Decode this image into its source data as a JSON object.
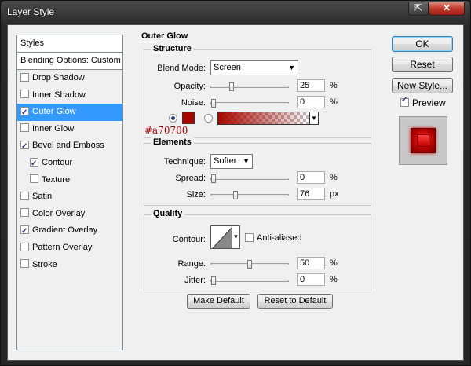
{
  "window": {
    "title": "Layer Style"
  },
  "styles_list": {
    "header": "Styles",
    "blending_options": "Blending Options: Custom",
    "items": [
      {
        "label": "Drop Shadow",
        "checked": false,
        "selected": false,
        "indent": false
      },
      {
        "label": "Inner Shadow",
        "checked": false,
        "selected": false,
        "indent": false
      },
      {
        "label": "Outer Glow",
        "checked": true,
        "selected": true,
        "indent": false
      },
      {
        "label": "Inner Glow",
        "checked": false,
        "selected": false,
        "indent": false
      },
      {
        "label": "Bevel and Emboss",
        "checked": true,
        "selected": false,
        "indent": false
      },
      {
        "label": "Contour",
        "checked": true,
        "selected": false,
        "indent": true
      },
      {
        "label": "Texture",
        "checked": false,
        "selected": false,
        "indent": true
      },
      {
        "label": "Satin",
        "checked": false,
        "selected": false,
        "indent": false
      },
      {
        "label": "Color Overlay",
        "checked": false,
        "selected": false,
        "indent": false
      },
      {
        "label": "Gradient Overlay",
        "checked": true,
        "selected": false,
        "indent": false
      },
      {
        "label": "Pattern Overlay",
        "checked": false,
        "selected": false,
        "indent": false
      },
      {
        "label": "Stroke",
        "checked": false,
        "selected": false,
        "indent": false
      }
    ]
  },
  "panel": {
    "title": "Outer Glow",
    "structure": {
      "title": "Structure",
      "blend_mode_label": "Blend Mode:",
      "blend_mode_value": "Screen",
      "opacity_label": "Opacity:",
      "opacity_value": "25",
      "opacity_fraction": 0.25,
      "noise_label": "Noise:",
      "noise_value": "0",
      "noise_fraction": 0.0,
      "percent": "%",
      "color_hex_label": "#a70700",
      "color": "#a70700"
    },
    "elements": {
      "title": "Elements",
      "technique_label": "Technique:",
      "technique_value": "Softer",
      "spread_label": "Spread:",
      "spread_value": "0",
      "spread_fraction": 0.0,
      "size_label": "Size:",
      "size_value": "76",
      "size_unit": "px",
      "size_fraction": 0.3
    },
    "quality": {
      "title": "Quality",
      "contour_label": "Contour:",
      "anti_aliased_label": "Anti-aliased",
      "range_label": "Range:",
      "range_value": "50",
      "range_fraction": 0.5,
      "jitter_label": "Jitter:",
      "jitter_value": "0",
      "jitter_fraction": 0.0
    },
    "make_default": "Make Default",
    "reset_to_default": "Reset to Default"
  },
  "actions": {
    "ok": "OK",
    "reset": "Reset",
    "new_style": "New Style...",
    "preview_label": "Preview",
    "preview_checked": true
  }
}
